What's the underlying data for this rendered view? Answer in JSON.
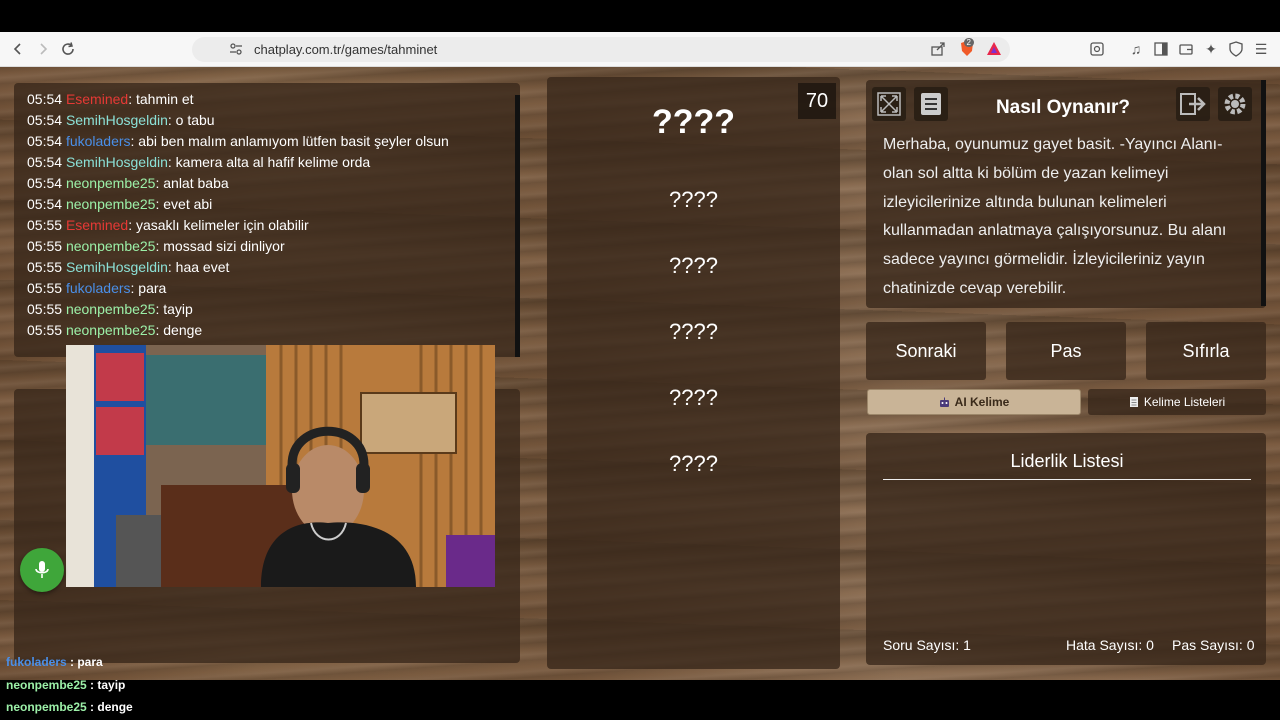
{
  "browser": {
    "url": "chatplay.com.tr/games/tahminet",
    "brave_badge": "2",
    "icons": [
      "back-icon",
      "forward-icon",
      "reload-icon",
      "bookmark-icon",
      "site-info-icon",
      "share-icon",
      "brave-shields-icon",
      "brave-rewards-icon",
      "reader-icon",
      "media-icon",
      "sidebar-icon",
      "wallet-icon",
      "leo-icon",
      "vpn-icon",
      "menu-icon"
    ]
  },
  "chat": {
    "messages": [
      {
        "time": "05:54",
        "user": "Esemined",
        "color": "#e53935",
        "text": ": tahmin et"
      },
      {
        "time": "05:54",
        "user": "SemihHosgeldin",
        "color": "#8be0d6",
        "text": ": o tabu"
      },
      {
        "time": "05:54",
        "user": "fukoladers",
        "color": "#4a8fe8",
        "text": ": abi ben malım anlamıyom lütfen basit şeyler olsun"
      },
      {
        "time": "05:54",
        "user": "SemihHosgeldin",
        "color": "#8be0d6",
        "text": ": kamera alta al hafif kelime orda"
      },
      {
        "time": "05:54",
        "user": "neonpembe25",
        "color": "#9cf0a8",
        "text": ": anlat baba"
      },
      {
        "time": "05:54",
        "user": "neonpembe25",
        "color": "#9cf0a8",
        "text": ": evet abi"
      },
      {
        "time": "05:55",
        "user": "Esemined",
        "color": "#e53935",
        "text": ": yasaklı kelimeler için olabilir"
      },
      {
        "time": "05:55",
        "user": "neonpembe25",
        "color": "#9cf0a8",
        "text": ": mossad sizi dinliyor"
      },
      {
        "time": "05:55",
        "user": "SemihHosgeldin",
        "color": "#8be0d6",
        "text": ": haa evet"
      },
      {
        "time": "05:55",
        "user": "fukoladers",
        "color": "#4a8fe8",
        "text": ": para"
      },
      {
        "time": "05:55",
        "user": "neonpembe25",
        "color": "#9cf0a8",
        "text": ": tayip"
      },
      {
        "time": "05:55",
        "user": "neonpembe25",
        "color": "#9cf0a8",
        "text": ": denge"
      }
    ]
  },
  "words": {
    "counter": "70",
    "main": "????",
    "forbidden": [
      "????",
      "????",
      "????",
      "????",
      "????"
    ]
  },
  "howto": {
    "title": "Nasıl Oynanır?",
    "text": "Merhaba, oyunumuz gayet basit. -Yayıncı Alanı- olan sol altta ki bölüm de yazan kelimeyi izleyicilerinize altında bulunan kelimeleri kullanmadan anlatmaya çalışıyorsunuz. Bu alanı sadece yayıncı görmelidir. İzleyicileriniz yayın chatinizde cevap verebilir."
  },
  "actions": {
    "next": "Sonraki",
    "pass": "Pas",
    "reset": "Sıfırla"
  },
  "tabs": {
    "ai": "AI Kelime",
    "lists": "Kelime Listeleri"
  },
  "leaderboard": {
    "title": "Liderlik Listesi",
    "questions": "Soru Sayısı: 1",
    "errors": "Hata Sayısı: 0",
    "passes": "Pas Sayısı: 0"
  },
  "overlay_chat": [
    {
      "user": "fukoladers",
      "color": "#4a8fe8",
      "text": " : para"
    },
    {
      "user": "neonpembe25",
      "color": "#9cf0a8",
      "text": " : tayip"
    },
    {
      "user": "neonpembe25",
      "color": "#9cf0a8",
      "text": " : denge"
    }
  ]
}
